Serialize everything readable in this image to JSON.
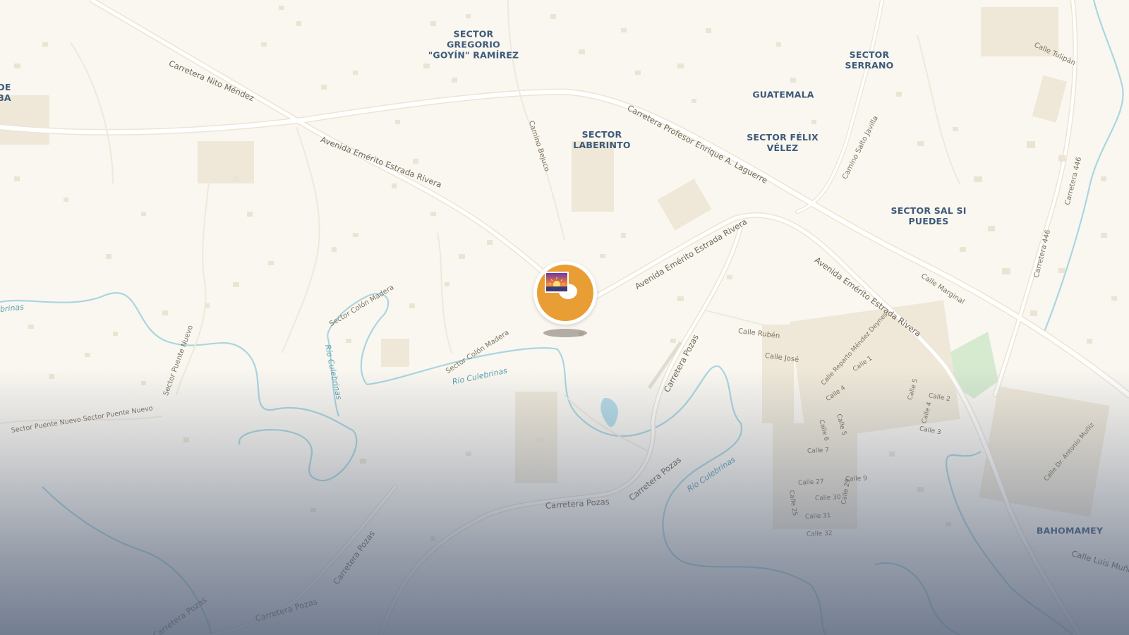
{
  "map": {
    "colors": {
      "land": "#faf7f0",
      "road": "#ffffff",
      "road_casing": "#ece5d4",
      "building": "#ebe4d3",
      "water_line": "#a9d6e0",
      "park": "#cfe8c4",
      "place_label": "#3d5a7a",
      "marker": "#e89e34"
    },
    "places": [
      {
        "id": "de-ba",
        "text": "DE\nBA"
      },
      {
        "id": "sector-gregorio",
        "text": "SECTOR\nGREGORIO\n\"GOYÍN\" RAMÍREZ"
      },
      {
        "id": "sector-serrano",
        "text": "SECTOR\nSERRANO"
      },
      {
        "id": "guatemala",
        "text": "GUATEMALA"
      },
      {
        "id": "sector-laberinto",
        "text": "SECTOR\nLABERINTO"
      },
      {
        "id": "sector-felix-velez",
        "text": "SECTOR FÉLIX\nVÉLEZ"
      },
      {
        "id": "sector-sal-si-puedes",
        "text": "SECTOR SAL SI\nPUEDES"
      },
      {
        "id": "bahomamey",
        "text": "BAHOMAMEY"
      }
    ],
    "roads": [
      {
        "id": "carretera-nito-mendez",
        "text": "Carretera Nito Méndez"
      },
      {
        "id": "avenida-emerito-1",
        "text": "Avenida Emérito Estrada Rivera"
      },
      {
        "id": "carretera-profesor",
        "text": "Carretera Profesor Enrique A. Laguerre"
      },
      {
        "id": "camino-bejuco",
        "text": "Camino Bejuco"
      },
      {
        "id": "camino-salto-javilla",
        "text": "Camino Salto Javilla"
      },
      {
        "id": "calle-tulipan",
        "text": "Calle Tulipán"
      },
      {
        "id": "carretera-446-a",
        "text": "Carretera 446"
      },
      {
        "id": "carretera-446-b",
        "text": "Carretera 446"
      },
      {
        "id": "avenida-emerito-2",
        "text": "Avenida Emérito Estrada Rivera"
      },
      {
        "id": "avenida-emerito-3",
        "text": "Avenida Emérito Estrada Rivera"
      },
      {
        "id": "calle-marginal",
        "text": "Calle Marginal"
      },
      {
        "id": "sector-colon-madera-1",
        "text": "Sector Colón Madera"
      },
      {
        "id": "sector-colon-madera-2",
        "text": "Sector Colón Madera"
      },
      {
        "id": "sector-puente-nuevo-1",
        "text": "Sector Puente Nuevo"
      },
      {
        "id": "sector-puente-nuevo-2",
        "text": "Sector Puente Nuevo Sector Puente Nuevo"
      },
      {
        "id": "calle-ruben",
        "text": "Calle Rubén"
      },
      {
        "id": "calle-jose",
        "text": "Calle José"
      },
      {
        "id": "calle-reparto",
        "text": "Calle Reparto Méndez Deynes"
      },
      {
        "id": "calle-1",
        "text": "Calle 1"
      },
      {
        "id": "calle-4a",
        "text": "Calle 4"
      },
      {
        "id": "calle-6",
        "text": "Calle 6"
      },
      {
        "id": "calle-5a",
        "text": "Calle 5"
      },
      {
        "id": "calle-5b",
        "text": "Calle 5"
      },
      {
        "id": "calle-4b",
        "text": "Calle 4"
      },
      {
        "id": "calle-2",
        "text": "Calle 2"
      },
      {
        "id": "calle-3",
        "text": "Calle 3"
      },
      {
        "id": "calle-7",
        "text": "Calle 7"
      },
      {
        "id": "calle-27",
        "text": "Calle 27"
      },
      {
        "id": "calle-9",
        "text": "Calle 9"
      },
      {
        "id": "calle-30",
        "text": "Calle 30"
      },
      {
        "id": "calle-25",
        "text": "Calle 25"
      },
      {
        "id": "calle-31",
        "text": "Calle 31"
      },
      {
        "id": "calle-29",
        "text": "Calle 29"
      },
      {
        "id": "calle-32",
        "text": "Calle 32"
      },
      {
        "id": "carretera-pozas-1",
        "text": "Carretera Pozas"
      },
      {
        "id": "carretera-pozas-2",
        "text": "Carretera Pozas"
      },
      {
        "id": "carretera-pozas-3",
        "text": "Carretera Pozas"
      },
      {
        "id": "carretera-pozas-4",
        "text": "Carretera Pozas"
      },
      {
        "id": "carretera-pozas-5",
        "text": "Carretera Pozas"
      },
      {
        "id": "carretera-pozas-6",
        "text": "Carretera Pozas"
      },
      {
        "id": "calle-dr-antonio",
        "text": "Calle Dr. Antonio Muñiz"
      },
      {
        "id": "calle-luis",
        "text": "Calle Luis Muño"
      }
    ],
    "water": [
      {
        "id": "rio-culebrinas-1",
        "text": "Río Culebrinas"
      },
      {
        "id": "rio-culebrinas-2",
        "text": "Río Culebrinas"
      },
      {
        "id": "rio-culebrinas-3",
        "text": "Río Culebrinas"
      },
      {
        "id": "brinas",
        "text": "brinas"
      }
    ],
    "marker": {
      "icon": "sunset-photo-icon"
    }
  }
}
